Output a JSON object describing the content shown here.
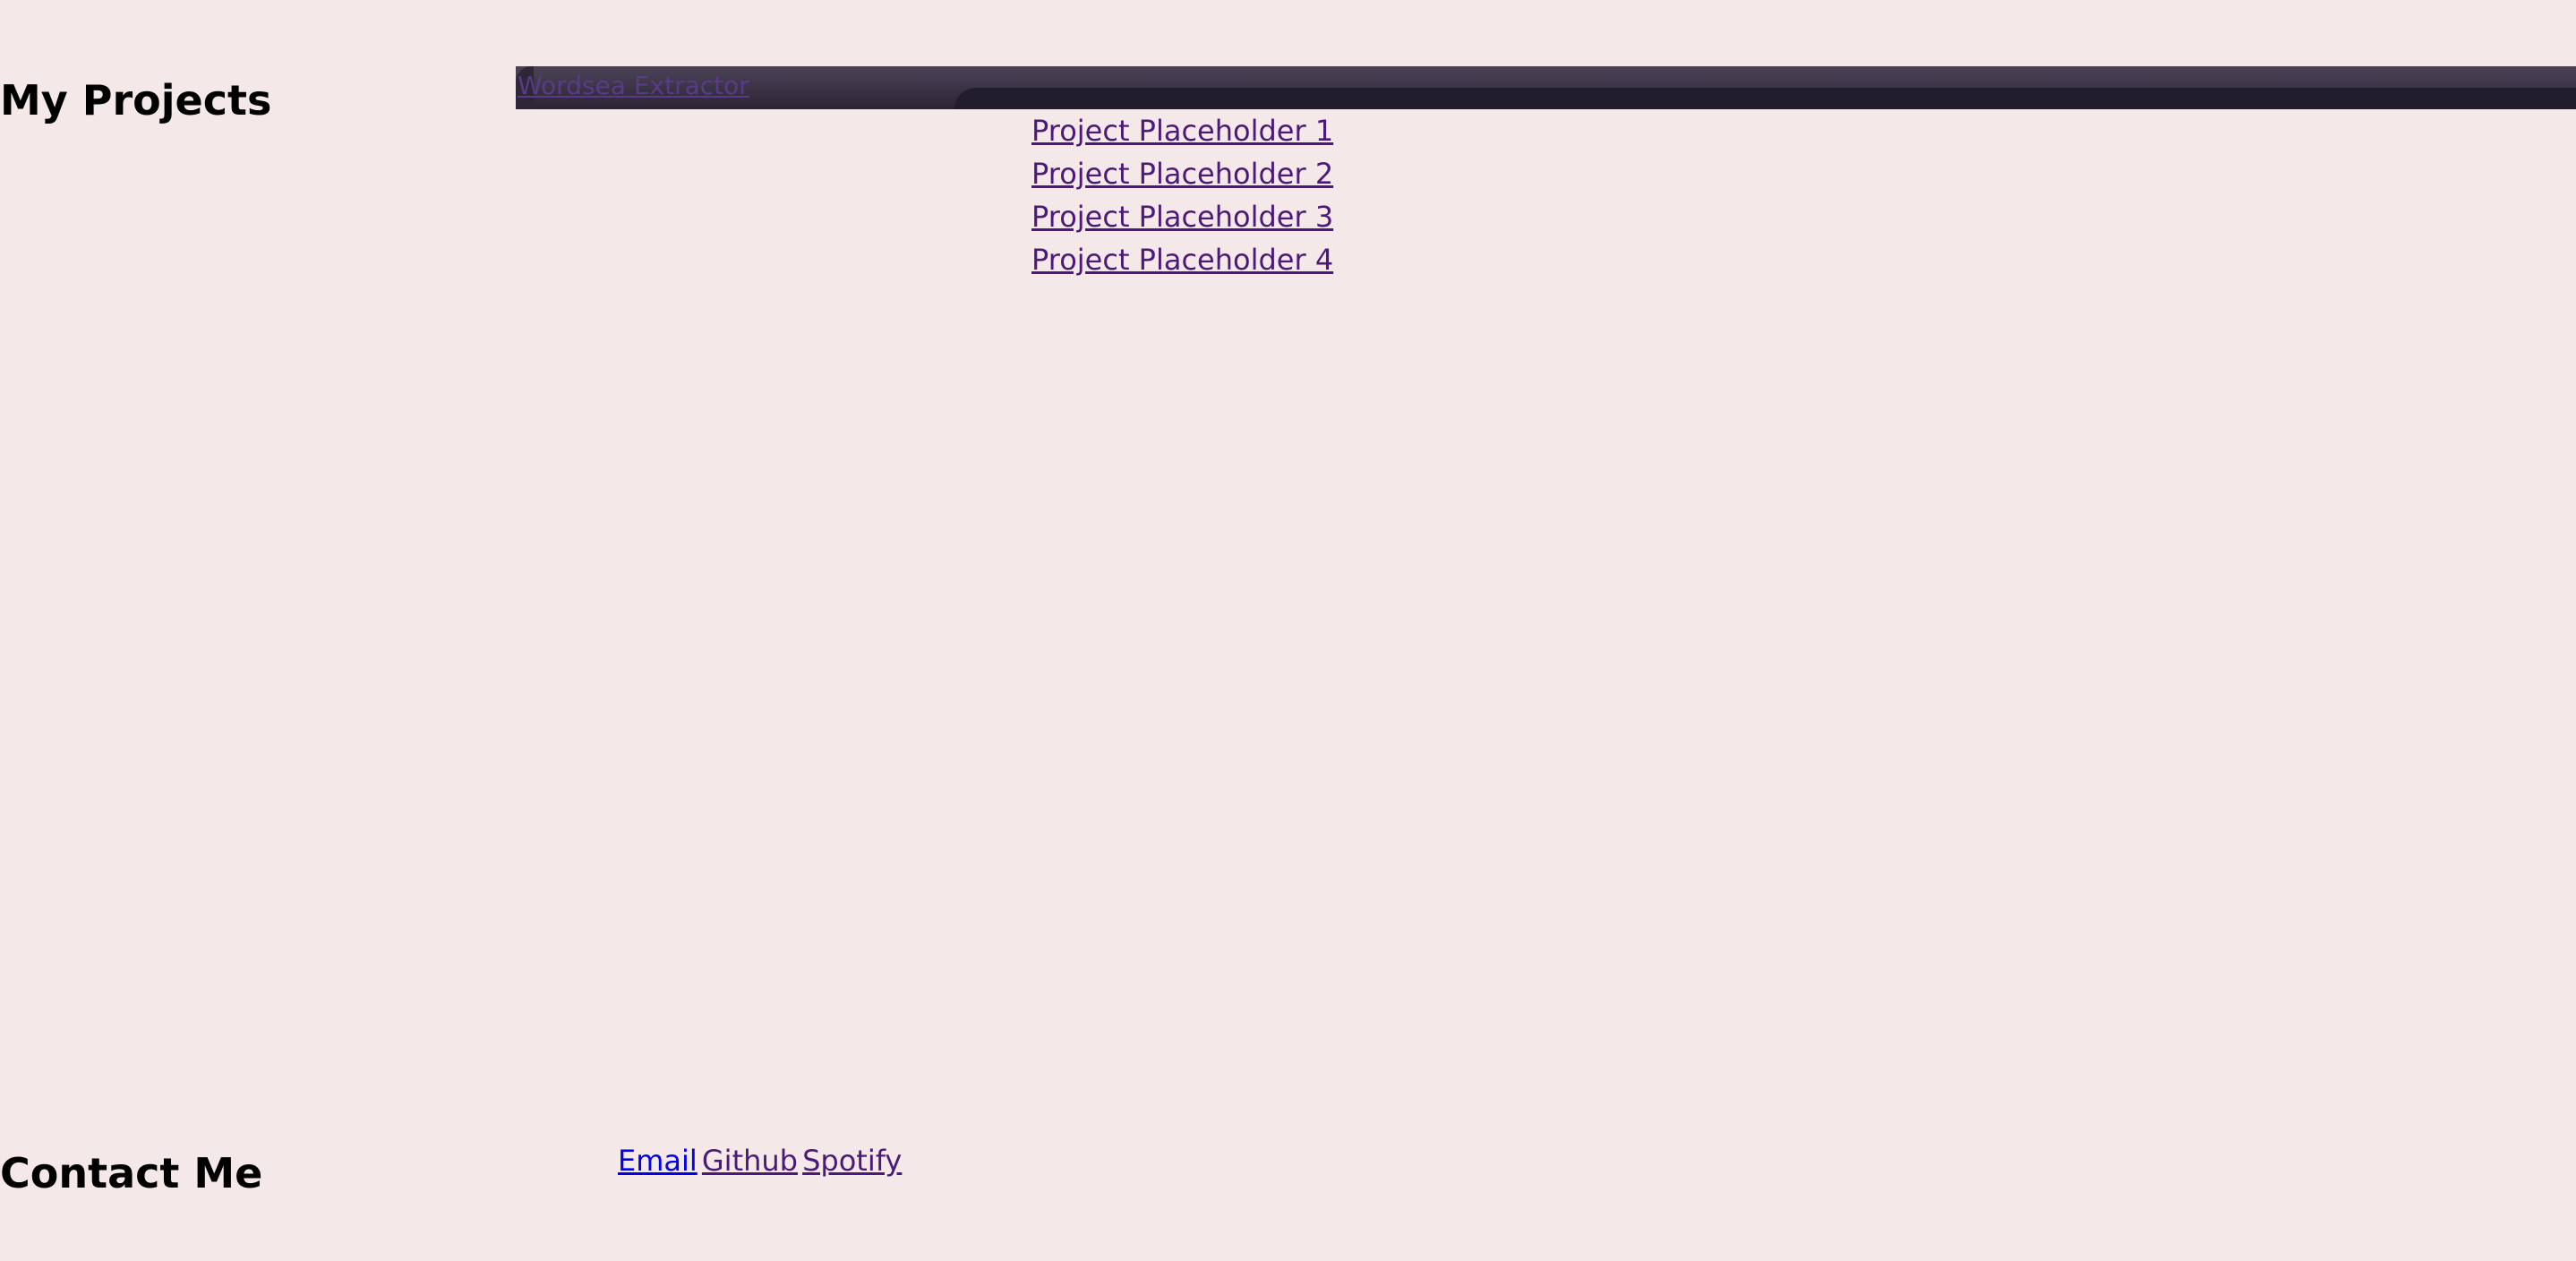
{
  "projects": {
    "heading": "My Projects",
    "featured_link": "Wordsea Extractor",
    "items": [
      {
        "label": "Project Placeholder 1"
      },
      {
        "label": "Project Placeholder 2"
      },
      {
        "label": "Project Placeholder 3"
      },
      {
        "label": "Project Placeholder 4"
      }
    ]
  },
  "contact": {
    "heading": "Contact Me",
    "links": [
      {
        "label": "Email"
      },
      {
        "label": "Github"
      },
      {
        "label": "Spotify"
      }
    ]
  },
  "colors": {
    "background": "#f5e8e9",
    "heading_text": "#000000",
    "visited_link": "#4b1a78",
    "unvisited_link": "#0000ee",
    "banner_dark": "#2a2434",
    "banner_light": "#4a4456"
  }
}
